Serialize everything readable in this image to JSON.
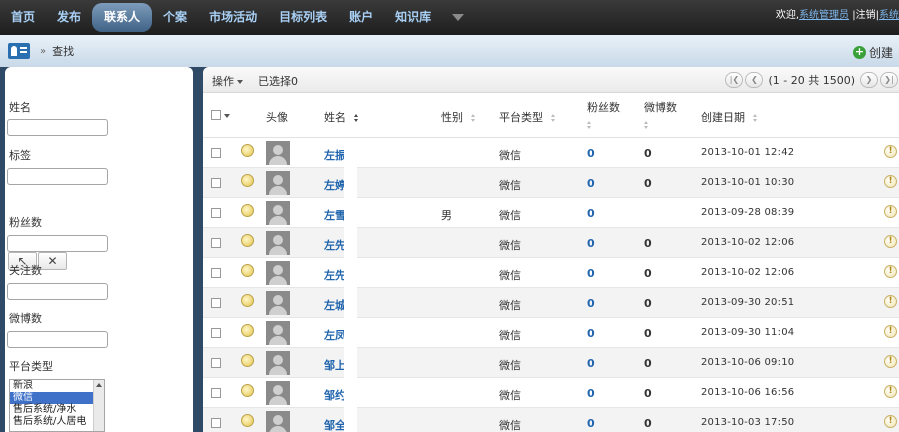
{
  "nav": {
    "items": [
      "首页",
      "发布",
      "联系人",
      "个案",
      "市场活动",
      "目标列表",
      "账户",
      "知识库"
    ],
    "active_index": 2,
    "welcome": "欢迎,",
    "user": "系统管理员",
    "separator": "|",
    "logout": "注销",
    "system": "系统"
  },
  "crumb": {
    "separator": "»",
    "title": "查找",
    "create_label": "创建"
  },
  "filters": {
    "name_label": "姓名",
    "tag_label": "标签",
    "fans_label": "粉丝数",
    "follow_label": "关注数",
    "weibo_label": "微博数",
    "platform_label": "平台类型",
    "platform_options": [
      "新浪",
      "微信",
      "售后系统/净水",
      "售后系统/人居电"
    ],
    "platform_selected": 1,
    "select_icon": "cursor-arrow-icon",
    "clear_icon": "close-x-icon"
  },
  "grid": {
    "ops_label": "操作",
    "selected_label": "已选择0",
    "pager_text": "(1 - 20 共 1500)",
    "columns": {
      "avatar": "头像",
      "name": "姓名",
      "gender": "性别",
      "platform": "平台类型",
      "fans": "粉丝数",
      "weibo": "微博数",
      "created": "创建日期"
    },
    "rows": [
      {
        "name": "左振",
        "gender": "",
        "platform": "微信",
        "fans": "0",
        "weibo": "0",
        "created": "2013-10-01 12:42"
      },
      {
        "name": "左婷",
        "gender": "",
        "platform": "微信",
        "fans": "0",
        "weibo": "0",
        "created": "2013-10-01 10:30"
      },
      {
        "name": "左雪",
        "gender": "男",
        "platform": "微信",
        "fans": "0",
        "weibo": "",
        "created": "2013-09-28 08:39"
      },
      {
        "name": "左先",
        "gender": "",
        "platform": "微信",
        "fans": "0",
        "weibo": "0",
        "created": "2013-10-02 12:06"
      },
      {
        "name": "左先",
        "gender": "",
        "platform": "微信",
        "fans": "0",
        "weibo": "0",
        "created": "2013-10-02 12:06"
      },
      {
        "name": "左城",
        "gender": "",
        "platform": "微信",
        "fans": "0",
        "weibo": "0",
        "created": "2013-09-30 20:51"
      },
      {
        "name": "左凤",
        "gender": "",
        "platform": "微信",
        "fans": "0",
        "weibo": "0",
        "created": "2013-09-30 11:04"
      },
      {
        "name": "邹上",
        "gender": "",
        "platform": "微信",
        "fans": "0",
        "weibo": "0",
        "created": "2013-10-06 09:10"
      },
      {
        "name": "邹约",
        "gender": "",
        "platform": "微信",
        "fans": "0",
        "weibo": "0",
        "created": "2013-10-06 16:56"
      },
      {
        "name": "邹全",
        "gender": "",
        "platform": "微信",
        "fans": "0",
        "weibo": "0",
        "created": "2013-10-03 17:50"
      }
    ]
  },
  "colors": {
    "nav_text": "#a9d0f5",
    "link_blue": "#1f64ad",
    "bg": "#2f4a66"
  }
}
